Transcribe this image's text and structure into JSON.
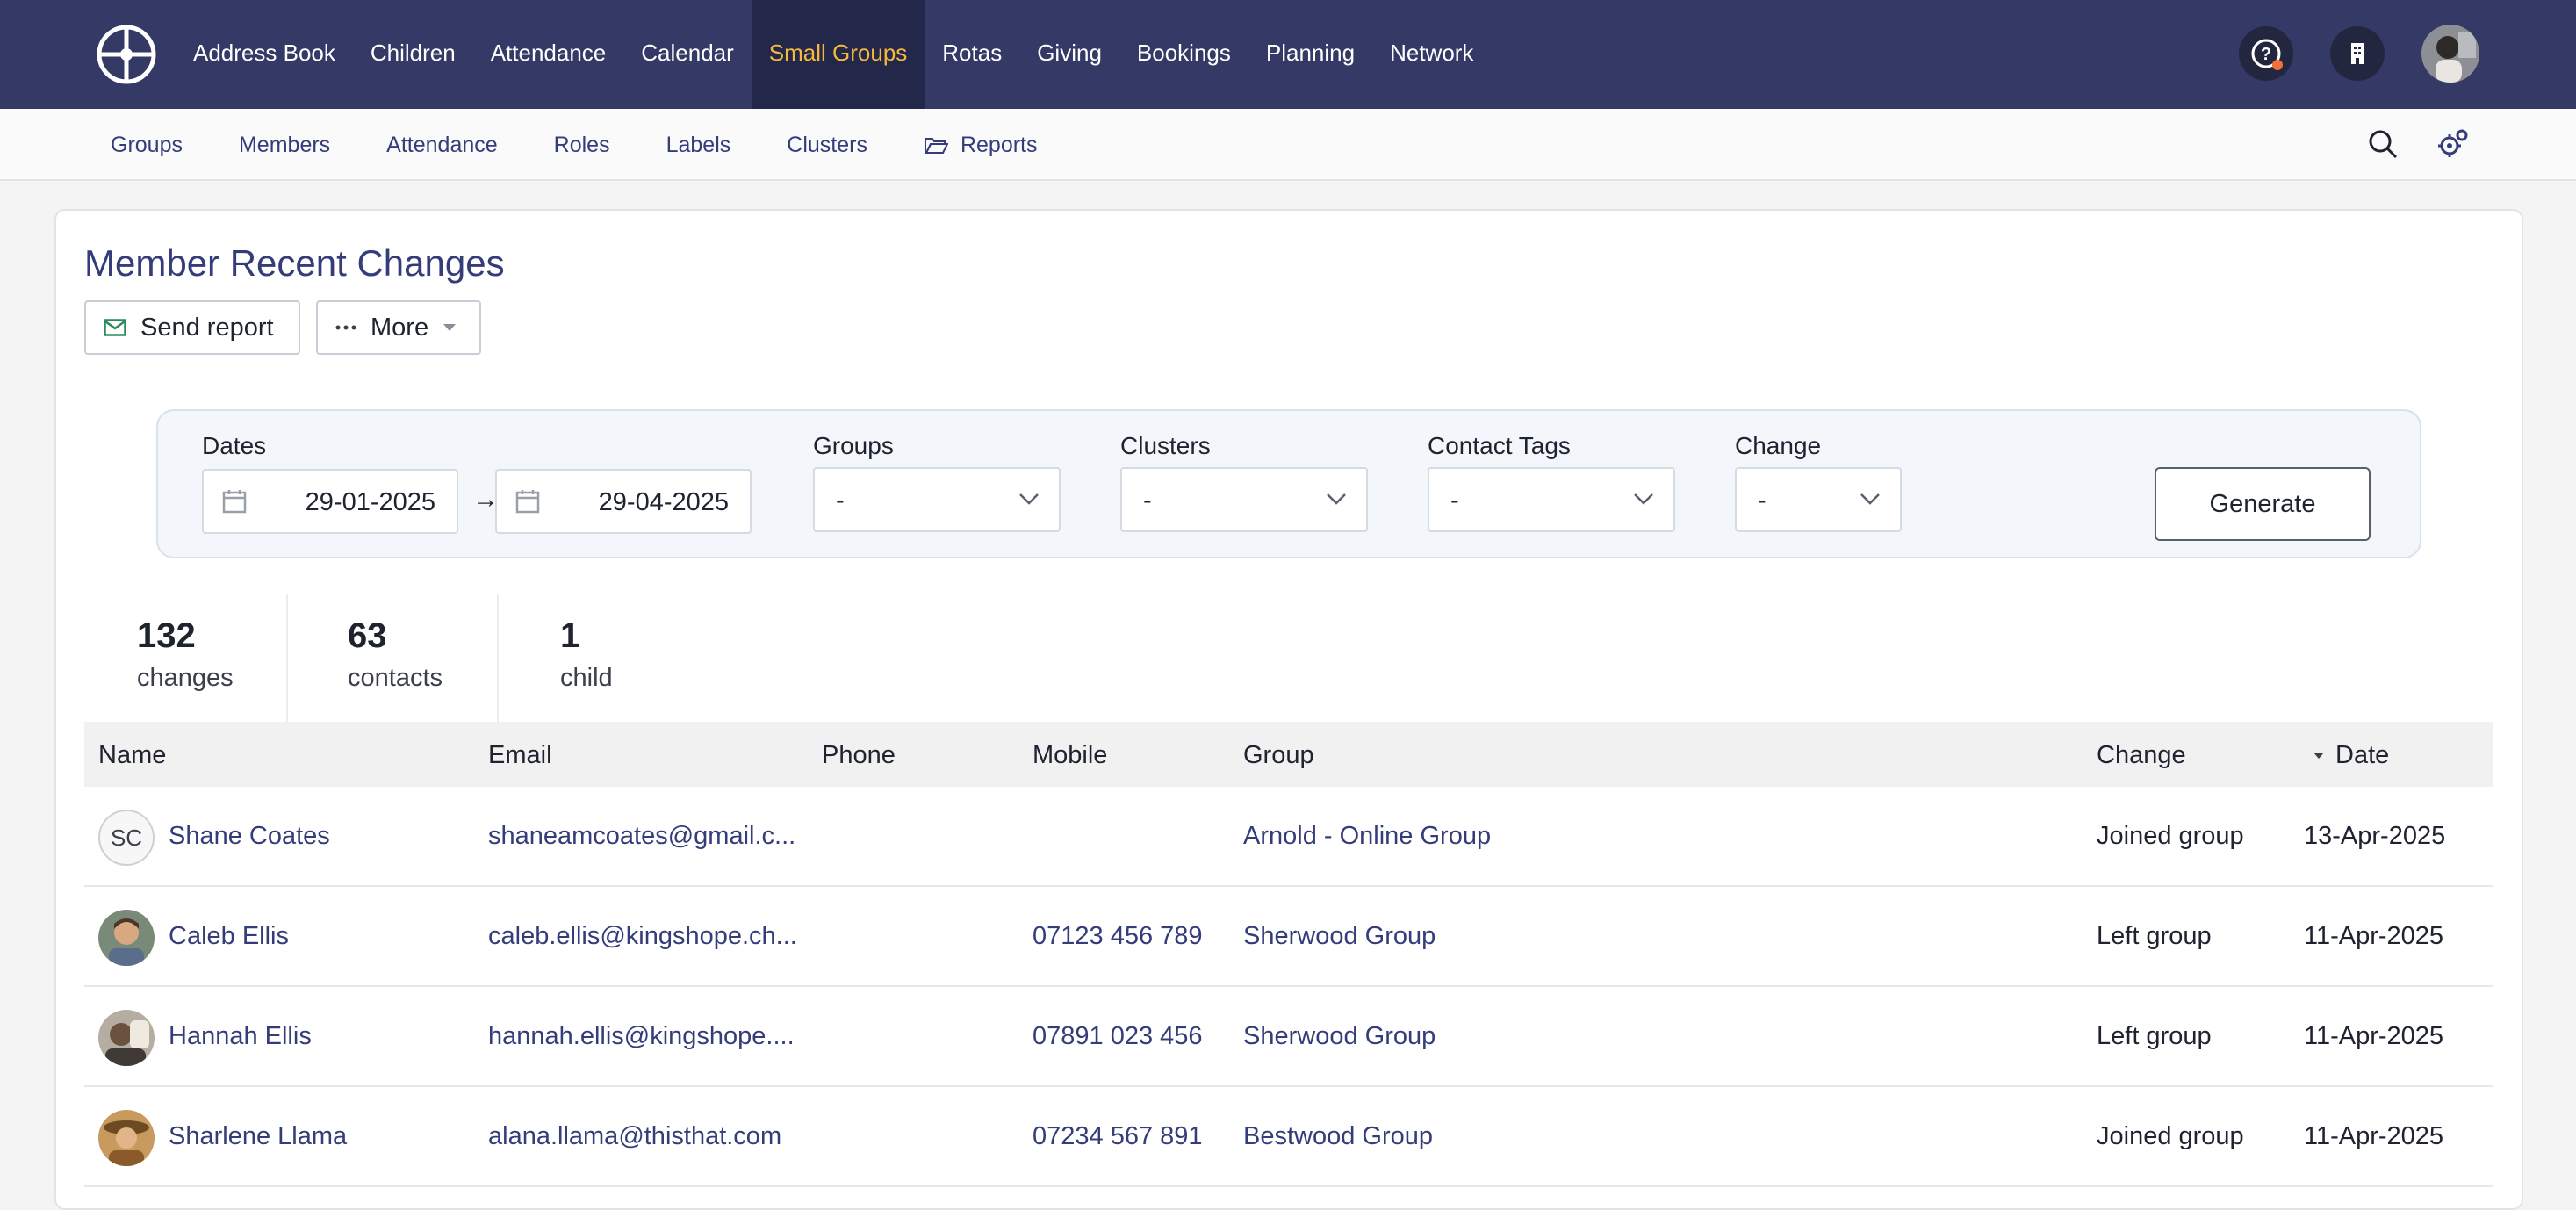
{
  "topnav": {
    "items": [
      "Address Book",
      "Children",
      "Attendance",
      "Calendar",
      "Small Groups",
      "Rotas",
      "Giving",
      "Bookings",
      "Planning",
      "Network"
    ],
    "active": "Small Groups",
    "icons": [
      "help-icon",
      "building-icon",
      "user-avatar"
    ]
  },
  "subnav": {
    "items": [
      "Groups",
      "Members",
      "Attendance",
      "Roles",
      "Labels",
      "Clusters",
      "Reports"
    ],
    "icons": [
      "folder-icon",
      "search-icon",
      "settings-gears-icon"
    ]
  },
  "page": {
    "title": "Member Recent Changes",
    "send_report": "Send report",
    "more": "More"
  },
  "filters": {
    "dates_label": "Dates",
    "date_from": "29-01-2025",
    "arrow": "→",
    "date_to": "29-04-2025",
    "groups_label": "Groups",
    "groups_value": "-",
    "clusters_label": "Clusters",
    "clusters_value": "-",
    "tags_label": "Contact Tags",
    "tags_value": "-",
    "change_label": "Change",
    "change_value": "-",
    "generate": "Generate"
  },
  "stats": [
    {
      "num": "132",
      "label": "changes"
    },
    {
      "num": "63",
      "label": "contacts"
    },
    {
      "num": "1",
      "label": "child"
    }
  ],
  "table": {
    "headers": {
      "name": "Name",
      "email": "Email",
      "phone": "Phone",
      "mobile": "Mobile",
      "group": "Group",
      "change": "Change",
      "date": "Date"
    },
    "sort": "date-desc",
    "rows": [
      {
        "initials": "SC",
        "name": "Shane Coates",
        "email": "shaneamcoates@gmail.c...",
        "phone": "",
        "mobile": "",
        "group": "Arnold - Online Group",
        "change": "Joined group",
        "date": "13-Apr-2025"
      },
      {
        "initials": "",
        "name": "Caleb Ellis",
        "email": "caleb.ellis@kingshope.ch...",
        "phone": "",
        "mobile": "07123 456 789",
        "group": "Sherwood Group",
        "change": "Left group",
        "date": "11-Apr-2025"
      },
      {
        "initials": "",
        "name": "Hannah Ellis",
        "email": "hannah.ellis@kingshope....",
        "phone": "",
        "mobile": "07891 023 456",
        "group": "Sherwood Group",
        "change": "Left group",
        "date": "11-Apr-2025"
      },
      {
        "initials": "",
        "name": "Sharlene Llama",
        "email": "alana.llama@thisthat.com",
        "phone": "",
        "mobile": "07234 567 891",
        "group": "Bestwood Group",
        "change": "Joined group",
        "date": "11-Apr-2025"
      }
    ]
  },
  "colors": {
    "nav_bg": "#343966",
    "active_text": "#f3b940",
    "link": "#343d7a"
  }
}
